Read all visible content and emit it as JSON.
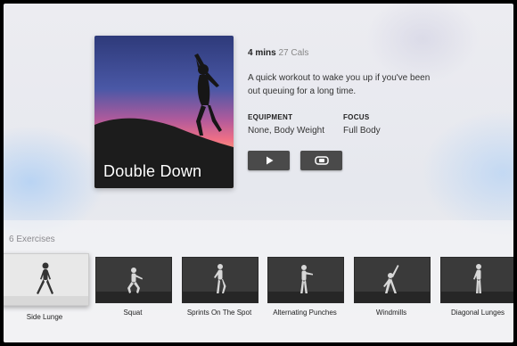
{
  "workout": {
    "title": "Double Down",
    "duration": "4 mins",
    "calories": "27 Cals",
    "description": "A quick workout to wake you up if you've been out queuing for a long time.",
    "equipment_label": "EQUIPMENT",
    "equipment_value": "None, Body Weight",
    "focus_label": "FOCUS",
    "focus_value": "Full Body",
    "play_icon": "play-icon",
    "watch_icon": "watch-icon"
  },
  "exercises": {
    "heading": "6 Exercises",
    "items": [
      {
        "label": "Side Lunge",
        "selected": true
      },
      {
        "label": "Squat"
      },
      {
        "label": "Sprints On The Spot"
      },
      {
        "label": "Alternating Punches"
      },
      {
        "label": "Windmills"
      },
      {
        "label": "Diagonal Lunges"
      }
    ]
  },
  "colors": {
    "button_bg": "#4a4a4a",
    "thumb_bg": "#3a3a3a",
    "sky_top": "#3b4a8c",
    "sky_mid": "#d9608a",
    "sky_low": "#f28a6a"
  }
}
